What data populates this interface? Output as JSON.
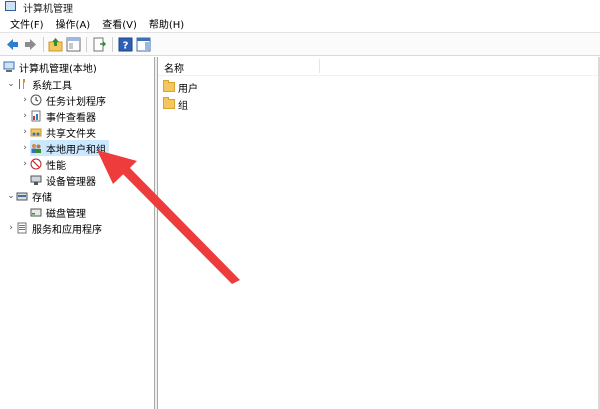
{
  "window": {
    "title": "计算机管理"
  },
  "menu": [
    {
      "label": "文件(F)"
    },
    {
      "label": "操作(A)"
    },
    {
      "label": "查看(V)"
    },
    {
      "label": "帮助(H)"
    }
  ],
  "tree": {
    "root": "计算机管理(本地)",
    "system_tools": "系统工具",
    "task_scheduler": "任务计划程序",
    "event_viewer": "事件查看器",
    "shared_folders": "共享文件夹",
    "local_users_groups": "本地用户和组",
    "performance": "性能",
    "device_manager": "设备管理器",
    "storage": "存储",
    "disk_management": "磁盘管理",
    "services_apps": "服务和应用程序"
  },
  "list": {
    "column_name": "名称",
    "items": [
      "用户",
      "组"
    ]
  },
  "colors": {
    "selection": "#cce8ff",
    "arrow": "#ee3b3b"
  }
}
